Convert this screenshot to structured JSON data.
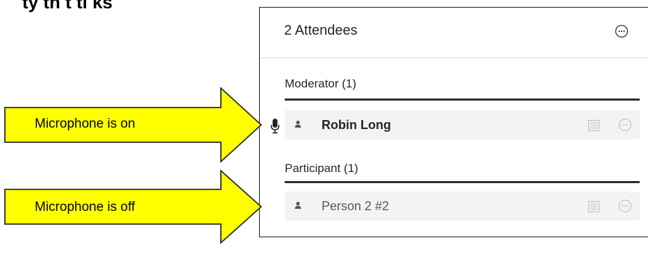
{
  "page": {
    "top_text": "ty    th         t         ti             ks"
  },
  "panel": {
    "title": "2 Attendees",
    "sections": [
      {
        "label": "Moderator (1)",
        "attendee": {
          "name": "Robin Long",
          "microphone": "on"
        }
      },
      {
        "label": "Participant (1)",
        "attendee": {
          "name": "Person 2 #2",
          "microphone": "off"
        }
      }
    ]
  },
  "callouts": [
    {
      "text": "Microphone is on"
    },
    {
      "text": "Microphone is off"
    }
  ],
  "colors": {
    "callout_fill": "#ffff00",
    "callout_stroke": "#2b2b2b",
    "row_background": "#f3f3f3",
    "section_rule": "#2b2b2b",
    "icon_gray": "#b8b8b8"
  },
  "icons": {
    "header_menu": "more-options-icon",
    "person": "person-icon",
    "microphone": "microphone-icon",
    "row_action": "list-icon",
    "row_menu": "more-options-icon"
  }
}
